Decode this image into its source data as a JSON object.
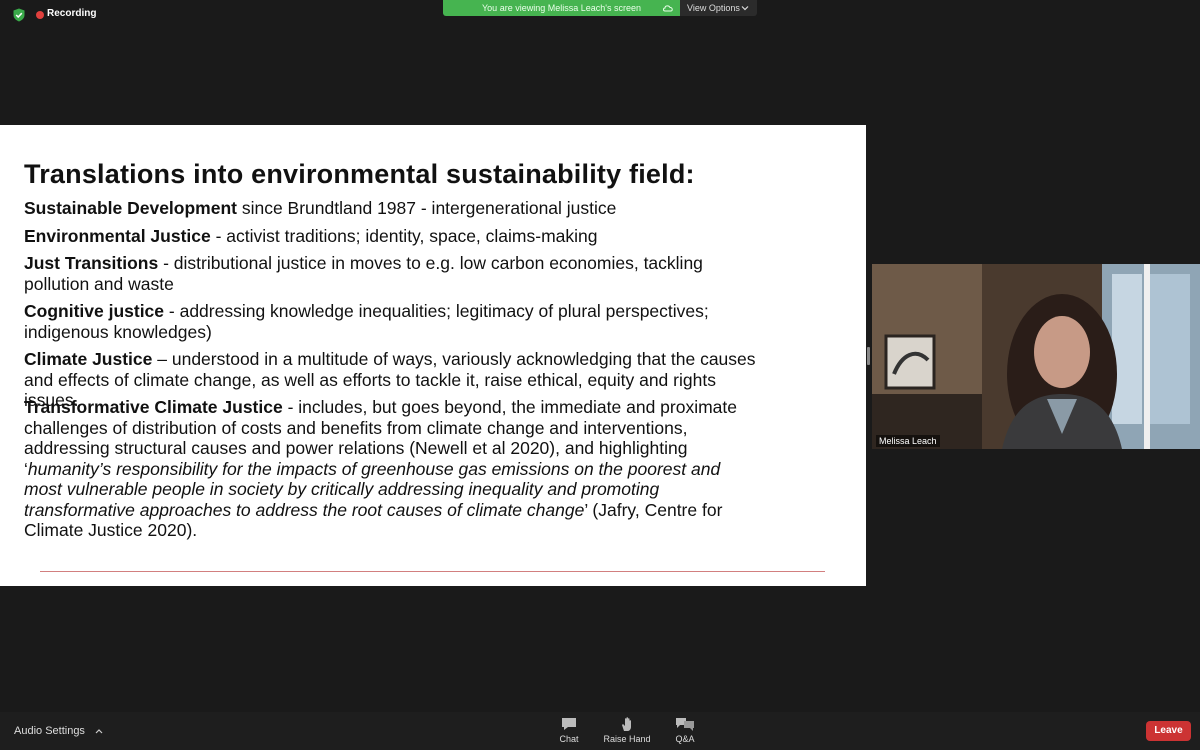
{
  "status": {
    "recording_label": "Recording",
    "banner_text": "You are viewing Melissa Leach's screen",
    "view_options_label": "View Options"
  },
  "slide": {
    "title": "Translations into environmental sustainability field:",
    "paragraphs": [
      {
        "term": "Sustainable Development",
        "text": " since Brundtland 1987 - intergenerational justice"
      },
      {
        "term": "Environmental Justice",
        "text": " - activist traditions; identity, space, claims-making"
      },
      {
        "term": "Just Transitions",
        "text": " - distributional justice in moves to e.g. low carbon economies, tackling pollution and waste"
      },
      {
        "term": "Cognitive justice",
        "text": " - addressing knowledge inequalities; legitimacy of plural perspectives; indigenous knowledges)"
      },
      {
        "term": "Climate Justice",
        "text": " – understood in a multitude of ways, variously acknowledging that the causes and effects of climate change, as well as efforts to tackle it, raise ethical, equity and rights issues."
      },
      {
        "term": "Transformative Climate Justice",
        "text": " - includes, but goes beyond, the immediate and proximate challenges of distribution of costs and benefits from climate change and interventions, addressing structural causes and power relations (Newell et al 2020), and highlighting ‘",
        "quote": "humanity’s responsibility for the impacts of greenhouse gas emissions on the poorest and most vulnerable people in society by critically addressing inequality and promoting transformative approaches to address the root causes of climate change",
        "tail": "’ (Jafry, Centre for Climate Justice 2020)."
      }
    ]
  },
  "video": {
    "participant_name": "Melissa Leach"
  },
  "toolbar": {
    "audio_settings_label": "Audio Settings",
    "chat_label": "Chat",
    "raise_hand_label": "Raise Hand",
    "qa_label": "Q&A",
    "leave_label": "Leave"
  },
  "colors": {
    "banner_green": "#46b450",
    "leave_red": "#cc3333",
    "recording_red": "#e0403d"
  }
}
